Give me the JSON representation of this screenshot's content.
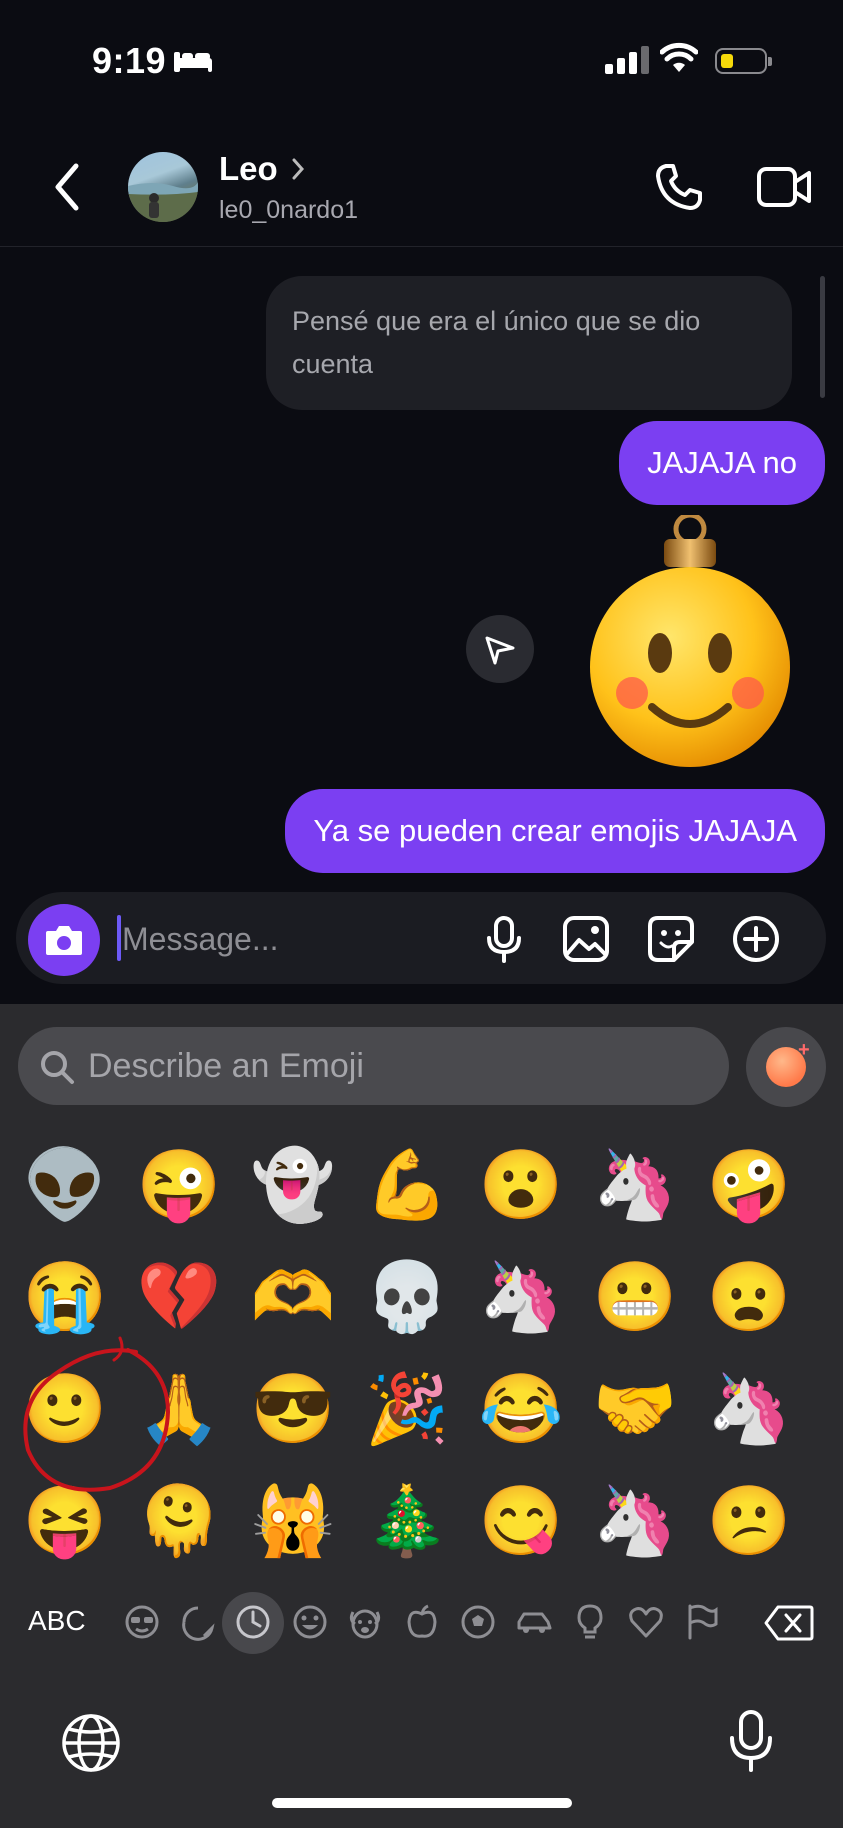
{
  "status_bar": {
    "time": "9:19"
  },
  "header": {
    "name": "Leo",
    "username": "le0_0nardo1"
  },
  "messages": [
    {
      "direction": "incoming",
      "text": "Pensé que era el único que se dio cuenta"
    },
    {
      "direction": "outgoing",
      "text": "JAJAJA no"
    },
    {
      "direction": "outgoing",
      "type": "genmoji",
      "text": "🙂"
    },
    {
      "direction": "outgoing",
      "text": "Ya se pueden crear emojis JAJAJA"
    }
  ],
  "composer": {
    "placeholder": "Message..."
  },
  "emoji_keyboard": {
    "search_placeholder": "Describe an Emoji",
    "rows": [
      [
        "👽",
        "😜",
        "👻",
        "💪",
        "😮",
        "🦄",
        "🤪"
      ],
      [
        "😭",
        "💔",
        "🫶",
        "💀",
        "🦄",
        "😬",
        "😦"
      ],
      [
        "🙂",
        "🙏",
        "😎",
        "🎉",
        "😂",
        "🤝",
        "🦄"
      ],
      [
        "😝",
        "🫠",
        "🙀",
        "🎄",
        "😋",
        "🦄",
        "😕"
      ]
    ],
    "abc_label": "ABC",
    "categories": [
      "memoji",
      "stickers",
      "recents",
      "smileys",
      "animals",
      "food",
      "activity",
      "travel",
      "objects",
      "symbols",
      "flags"
    ]
  },
  "accent_color": "#7b3ff2"
}
